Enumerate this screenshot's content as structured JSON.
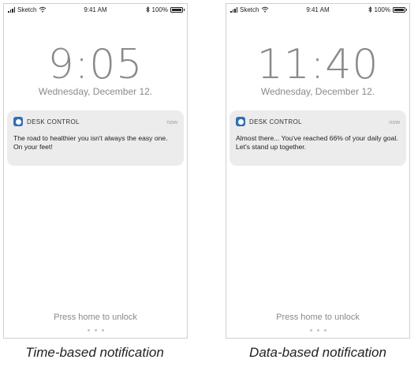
{
  "phones": [
    {
      "status_bar": {
        "carrier": "Sketch",
        "time": "9:41 AM",
        "battery": "100%"
      },
      "clock": "9:05",
      "date": "Wednesday, December 12.",
      "notification": {
        "app_name": "DESK CONTROL",
        "time": "now",
        "message": "The road to healthier you isn't always the easy one. On your feet!"
      },
      "unlock_text": "Press home to unlock",
      "caption": "Time-based notification"
    },
    {
      "status_bar": {
        "carrier": "Sketch",
        "time": "9:41 AM",
        "battery": "100%"
      },
      "clock": "11:40",
      "date": "Wednesday, December 12.",
      "notification": {
        "app_name": "DESK CONTROL",
        "time": "now",
        "message": "Almost there... You've reached 66% of your daily goal. Let's stand up together."
      },
      "unlock_text": "Press home to unlock",
      "caption": "Data-based notification"
    }
  ],
  "colors": {
    "app_icon": "#2f6fb5",
    "notification_bg": "#ececec",
    "clock_text": "#8a8a8a"
  },
  "icons": [
    "signal-icon",
    "wifi-icon",
    "bluetooth-icon",
    "battery-icon",
    "desk-control-app-icon"
  ]
}
